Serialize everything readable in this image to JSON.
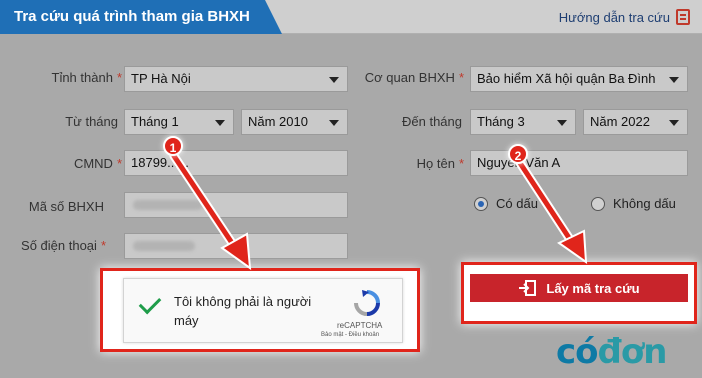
{
  "header": {
    "title": "Tra cứu quá trình tham gia BHXH",
    "guide_link": "Hướng dẫn tra cứu"
  },
  "form": {
    "province": {
      "label": "Tỉnh thành",
      "value": "TP Hà Nội"
    },
    "agency": {
      "label": "Cơ quan BHXH",
      "value": "Bảo hiểm Xã hội quận Ba Đình"
    },
    "from": {
      "label": "Từ tháng",
      "month": "Tháng 1",
      "year": "Năm 2010"
    },
    "to": {
      "label": "Đến tháng",
      "month": "Tháng 3",
      "year": "Năm 2022"
    },
    "id_card": {
      "label": "CMND",
      "value": "18799......"
    },
    "full_name": {
      "label": "Họ tên",
      "value": "Nguyễn Văn A"
    },
    "insurance_code": {
      "label": "Mã số BHXH"
    },
    "phone": {
      "label": "Số điện thoại"
    },
    "accent": {
      "with": "Có dấu",
      "without": "Không dấu",
      "selected": "with"
    },
    "required_mark": "*"
  },
  "captcha": {
    "text": "Tôi không phải là người máy",
    "brand": "reCAPTCHA",
    "links": "Bảo mật - Điều khoản"
  },
  "submit_label": "Lấy mã tra cứu",
  "markers": [
    "1",
    "2"
  ],
  "watermark": {
    "part1": "có",
    "part2": "đơn"
  },
  "colors": {
    "header_blue": "#1f6fb6",
    "button_red": "#c8242b",
    "highlight_red": "#e0251b",
    "check_green": "#1f9d4a"
  }
}
